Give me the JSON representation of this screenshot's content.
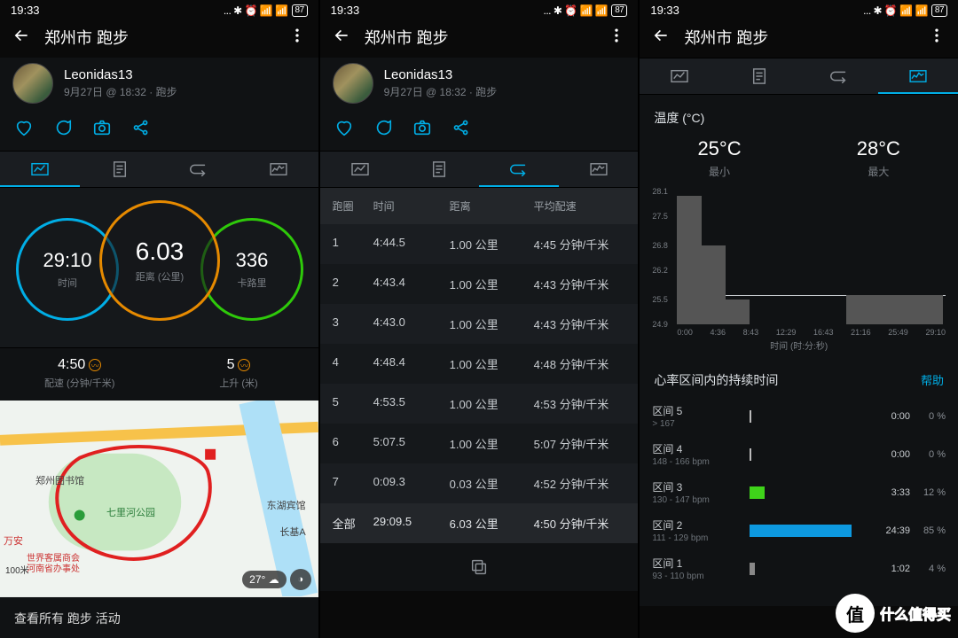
{
  "status": {
    "time": "19:33",
    "battery": "87"
  },
  "header": {
    "title": "郑州市 跑步"
  },
  "user": {
    "name": "Leonidas13",
    "subtitle": "9月27日 @ 18:32 · 跑步"
  },
  "screen1": {
    "rings": {
      "time": {
        "value": "29:10",
        "label": "时间"
      },
      "dist": {
        "value": "6.03",
        "label": "距离 (公里)"
      },
      "cal": {
        "value": "336",
        "label": "卡路里"
      }
    },
    "pace": {
      "value": "4:50",
      "label": "配速 (分钟/千米)"
    },
    "elev": {
      "value": "5",
      "label": "上升 (米)"
    },
    "map": {
      "temp": "27°",
      "scale": "100米",
      "pois": [
        "郑州图书馆",
        "七里河公园",
        "东湖宾馆",
        "长基A",
        "万安",
        "世界客属商会",
        "河南省办事处"
      ]
    },
    "view_all": "查看所有 跑步 活动"
  },
  "screen2": {
    "cols": {
      "lap": "跑圈",
      "time": "时间",
      "dist": "距离",
      "pace": "平均配速"
    },
    "laps": [
      {
        "lap": "1",
        "time": "4:44.5",
        "dist": "1.00 公里",
        "pace": "4:45 分钟/千米"
      },
      {
        "lap": "2",
        "time": "4:43.4",
        "dist": "1.00 公里",
        "pace": "4:43 分钟/千米"
      },
      {
        "lap": "3",
        "time": "4:43.0",
        "dist": "1.00 公里",
        "pace": "4:43 分钟/千米"
      },
      {
        "lap": "4",
        "time": "4:48.4",
        "dist": "1.00 公里",
        "pace": "4:48 分钟/千米"
      },
      {
        "lap": "5",
        "time": "4:53.5",
        "dist": "1.00 公里",
        "pace": "4:53 分钟/千米"
      },
      {
        "lap": "6",
        "time": "5:07.5",
        "dist": "1.00 公里",
        "pace": "5:07 分钟/千米"
      },
      {
        "lap": "7",
        "time": "0:09.3",
        "dist": "0.03 公里",
        "pace": "4:52 分钟/千米"
      }
    ],
    "total": {
      "lap": "全部",
      "time": "29:09.5",
      "dist": "6.03 公里",
      "pace": "4:50 分钟/千米"
    }
  },
  "screen3": {
    "temp_section": "温度 (°C)",
    "min": {
      "value": "25°C",
      "label": "最小"
    },
    "max": {
      "value": "28°C",
      "label": "最大"
    },
    "x_axis_label": "时间 (时:分:秒)",
    "hr_section": "心率区间内的持续时间",
    "help": "帮助",
    "zones": [
      {
        "name": "区间 5",
        "range": "> 167",
        "dur": "0:00",
        "pct": "0 %",
        "w": 0,
        "color": "#bbb"
      },
      {
        "name": "区间 4",
        "range": "148 - 166 bpm",
        "dur": "0:00",
        "pct": "0 %",
        "w": 0,
        "color": "#bbb"
      },
      {
        "name": "区间 3",
        "range": "130 - 147 bpm",
        "dur": "3:33",
        "pct": "12 %",
        "w": 12,
        "color": "#3fd31a"
      },
      {
        "name": "区间 2",
        "range": "111 - 129 bpm",
        "dur": "24:39",
        "pct": "85 %",
        "w": 85,
        "color": "#0d99e0"
      },
      {
        "name": "区间 1",
        "range": "93 - 110 bpm",
        "dur": "1:02",
        "pct": "4 %",
        "w": 4,
        "color": "#888"
      }
    ]
  },
  "chart_data": {
    "type": "line",
    "title": "温度 (°C)",
    "xlabel": "时间 (时:分:秒)",
    "ylabel": "°C",
    "ylim": [
      24.9,
      28.1
    ],
    "x_ticks": [
      "0:00",
      "4:36",
      "8:43",
      "12:29",
      "16:43",
      "21:16",
      "25:49",
      "29:10"
    ],
    "y_ticks": [
      24.9,
      25.5,
      26.2,
      26.8,
      27.5,
      28.1
    ],
    "series": [
      {
        "name": "温度",
        "x": [
          "0:00",
          "3:00",
          "6:00",
          "9:00",
          "12:00",
          "15:00",
          "18:00",
          "21:00",
          "24:00",
          "27:00",
          "29:10"
        ],
        "y": [
          28.0,
          26.8,
          25.5,
          24.9,
          24.9,
          24.9,
          24.9,
          25.6,
          25.6,
          25.6,
          25.6
        ]
      }
    ],
    "reference_lines": [
      {
        "axis": "y",
        "value": 25.6
      }
    ]
  },
  "watermark": "什么值得买"
}
